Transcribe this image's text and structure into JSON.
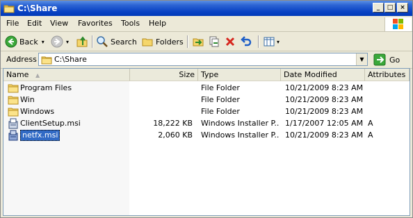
{
  "window": {
    "title": "C:\\Share"
  },
  "menubar": {
    "items": [
      "File",
      "Edit",
      "View",
      "Favorites",
      "Tools",
      "Help"
    ]
  },
  "toolbar": {
    "back_label": "Back",
    "search_label": "Search",
    "folders_label": "Folders"
  },
  "address": {
    "label": "Address",
    "value": "C:\\Share",
    "go_label": "Go"
  },
  "columns": {
    "name": "Name",
    "size": "Size",
    "type": "Type",
    "date": "Date Modified",
    "attributes": "Attributes"
  },
  "files": [
    {
      "name": "Program Files",
      "size": "",
      "type": "File Folder",
      "date": "10/21/2009 8:23 AM",
      "attributes": "",
      "icon": "folder-icon"
    },
    {
      "name": "Win",
      "size": "",
      "type": "File Folder",
      "date": "10/21/2009 8:23 AM",
      "attributes": "",
      "icon": "folder-icon"
    },
    {
      "name": "Windows",
      "size": "",
      "type": "File Folder",
      "date": "10/21/2009 8:23 AM",
      "attributes": "",
      "icon": "folder-icon"
    },
    {
      "name": "ClientSetup.msi",
      "size": "18,222 KB",
      "type": "Windows Installer P...",
      "date": "1/17/2007 12:05 AM",
      "attributes": "A",
      "icon": "msi-icon"
    },
    {
      "name": "netfx.msi",
      "size": "2,060 KB",
      "type": "Windows Installer P...",
      "date": "10/21/2009 8:23 AM",
      "attributes": "A",
      "icon": "msi-icon",
      "selected": true
    }
  ],
  "colors": {
    "titlebar": "#0a43c4",
    "selection": "#316ac5",
    "chrome": "#ece9d8"
  }
}
